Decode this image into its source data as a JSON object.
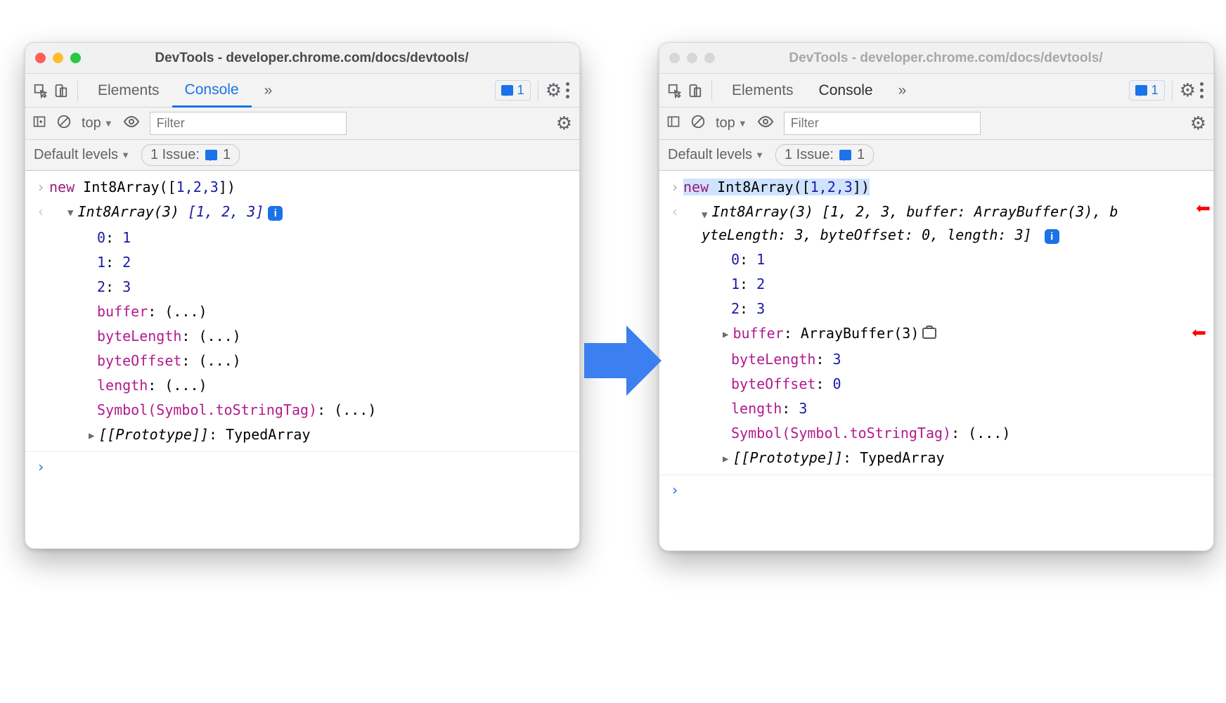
{
  "windowTitle": "DevTools - developer.chrome.com/docs/devtools/",
  "tabs": {
    "elements": "Elements",
    "console": "Console",
    "more": "»",
    "issuesCount": "1"
  },
  "filter": {
    "context": "top",
    "placeholder": "Filter"
  },
  "levels": {
    "label": "Default levels",
    "issuePrefix": "1 Issue:",
    "issueCount": "1"
  },
  "left": {
    "cmd": {
      "new": "new",
      "call": "Int8Array([",
      "args": "1,2,3",
      "close": "])"
    },
    "summary": {
      "type": "Int8Array(3)",
      "arr": "[1, 2, 3]"
    },
    "props": [
      {
        "k": "0",
        "v": "1"
      },
      {
        "k": "1",
        "v": "2"
      },
      {
        "k": "2",
        "v": "3"
      },
      {
        "k": "buffer",
        "v": "(...)"
      },
      {
        "k": "byteLength",
        "v": "(...)"
      },
      {
        "k": "byteOffset",
        "v": "(...)"
      },
      {
        "k": "length",
        "v": "(...)"
      },
      {
        "k": "Symbol(Symbol.toStringTag)",
        "v": "(...)"
      }
    ],
    "proto": {
      "k": "[[Prototype]]",
      "v": "TypedArray"
    }
  },
  "right": {
    "cmd": {
      "new": "new",
      "call": "Int8Array([",
      "args": "1,2,3",
      "close": "])"
    },
    "summary1": "Int8Array(3) [1, 2, 3, buffer: ArrayBuffer(3), b",
    "summary2": "yteLength: 3, byteOffset: 0, length: 3]",
    "props": [
      {
        "k": "0",
        "v": "1"
      },
      {
        "k": "1",
        "v": "2"
      },
      {
        "k": "2",
        "v": "3"
      }
    ],
    "bufferK": "buffer",
    "bufferV": "ArrayBuffer(3)",
    "more": [
      {
        "k": "byteLength",
        "v": "3"
      },
      {
        "k": "byteOffset",
        "v": "0"
      },
      {
        "k": "length",
        "v": "3"
      },
      {
        "k": "Symbol(Symbol.toStringTag)",
        "v": "(...)"
      }
    ],
    "proto": {
      "k": "[[Prototype]]",
      "v": "TypedArray"
    }
  }
}
